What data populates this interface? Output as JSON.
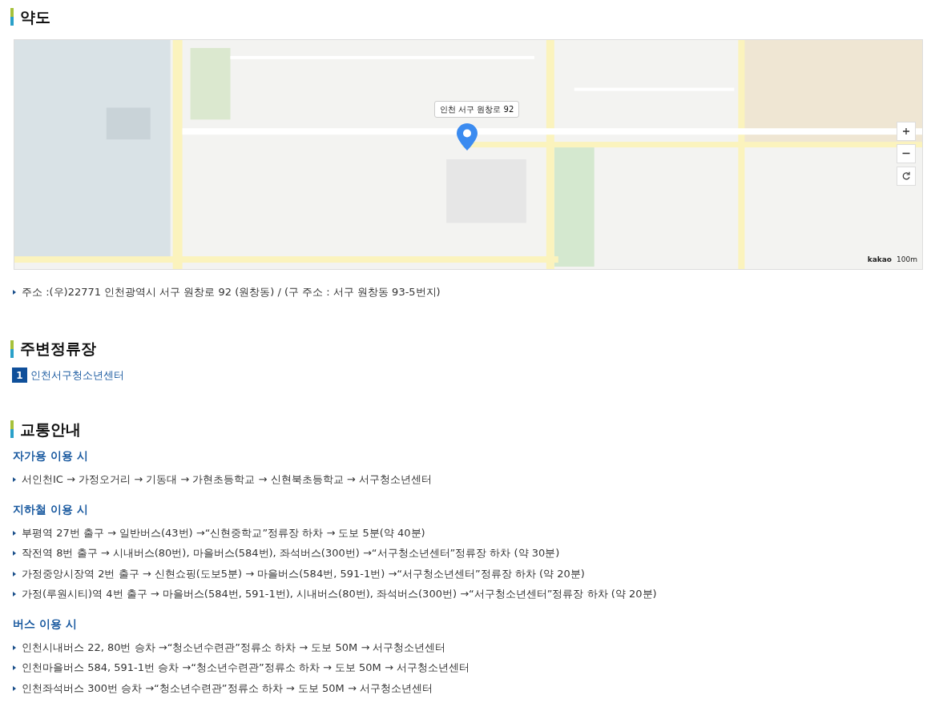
{
  "map_section": {
    "title": "약도",
    "marker_label": "인천 서구 원창로 92",
    "attribution": "kakao",
    "scale": "100m",
    "address": "주소 :(우)22771 인천광역시 서구 원창로 92 (원창동) / (구 주소 : 서구 원창동 93-5번지)"
  },
  "stops_section": {
    "title": "주변정류장",
    "stops": [
      {
        "number": "1",
        "name": "인천서구청소년센터"
      }
    ]
  },
  "traffic_section": {
    "title": "교통안내",
    "groups": [
      {
        "title": "자가용 이용 시",
        "items": [
          "서인천IC → 가정오거리 → 기동대 → 가현초등학교 → 신현북초등학교 → 서구청소년센터"
        ]
      },
      {
        "title": "지하철 이용 시",
        "items": [
          "부평역 27번 출구 → 일반버스(43번) →“신현중학교”정류장 하차 → 도보 5분(약 40분)",
          "작전역 8번 출구 → 시내버스(80번), 마을버스(584번), 좌석버스(300번) →“서구청소년센터”정류장 하차 (약 30분)",
          "가정중앙시장역 2번 출구 → 신현쇼핑(도보5분) → 마을버스(584번, 591-1번) →“서구청소년센터”정류장 하차 (약 20분)",
          "가정(루원시티)역 4번 출구 → 마을버스(584번, 591-1번), 시내버스(80번), 좌석버스(300번) →“서구청소년센터”정류장 하차 (약 20분)"
        ]
      },
      {
        "title": "버스 이용 시",
        "items": [
          "인천시내버스 22, 80번 승차 →“청소년수련관”정류소 하차 → 도보 50M → 서구청소년센터",
          "인천마을버스 584, 591-1번 승차 →“청소년수련관”정류소 하차 → 도보 50M → 서구청소년센터",
          "인천좌석버스 300번 승차 →“청소년수련관”정류소 하차 → 도보 50M → 서구청소년센터"
        ]
      }
    ]
  }
}
